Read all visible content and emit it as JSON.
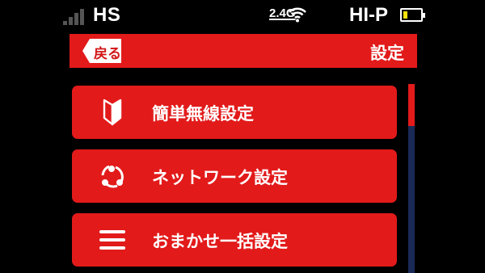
{
  "status_bar": {
    "network_type": "HS",
    "signal_bars_active": 0,
    "wifi_band": "2.4G",
    "mode": "HI-P",
    "battery_level": 0.25,
    "battery_color": "#f2e20e"
  },
  "header": {
    "back_label": "戻る",
    "title": "設定"
  },
  "menu": {
    "items": [
      {
        "icon": "beginner-mark-icon",
        "label": "簡単無線設定"
      },
      {
        "icon": "network-icon",
        "label": "ネットワーク設定"
      },
      {
        "icon": "menu-list-icon",
        "label": "おまかせ一括設定"
      }
    ]
  },
  "scrollbar": {
    "position": 0,
    "visible_fraction": 0.22
  },
  "colors": {
    "accent": "#e21a1a",
    "background": "#000000",
    "scroll_track": "#1a2a57"
  }
}
